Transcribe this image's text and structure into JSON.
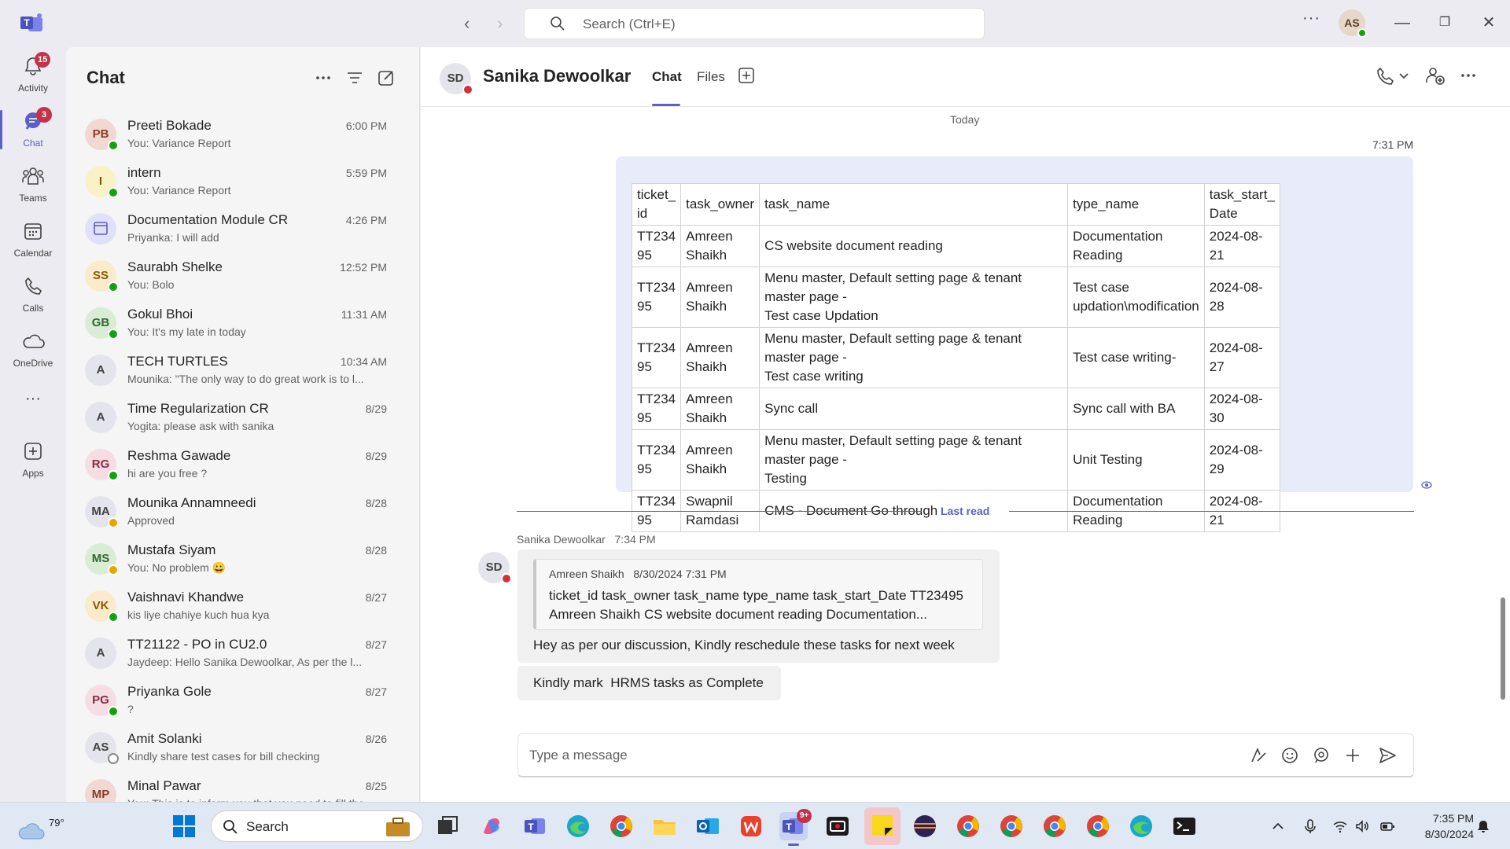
{
  "titlebar": {
    "search_placeholder": "Search (Ctrl+E)",
    "more_label": "···",
    "avatar_initials": "AS",
    "minimize": "—",
    "restore": "❐",
    "close": "✕"
  },
  "rail": {
    "items": [
      {
        "label": "Activity",
        "icon": "bell-icon",
        "badge": "15"
      },
      {
        "label": "Chat",
        "icon": "chat-icon",
        "badge": "3"
      },
      {
        "label": "Teams",
        "icon": "teams-icon"
      },
      {
        "label": "Calendar",
        "icon": "calendar-icon"
      },
      {
        "label": "Calls",
        "icon": "phone-icon"
      },
      {
        "label": "OneDrive",
        "icon": "cloud-icon"
      },
      {
        "label": "···",
        "icon": "more-icon"
      },
      {
        "label": "Apps",
        "icon": "plus-box-icon"
      }
    ]
  },
  "chatlist": {
    "title": "Chat",
    "items": [
      {
        "name": "Preeti Bokade",
        "preview": "You: Variance Report",
        "time": "6:00 PM",
        "initials": "PB",
        "status": "green",
        "av_bg": "#f1d9d2",
        "av_fg": "#8a3c2a"
      },
      {
        "name": "intern",
        "preview": "You: Variance Report",
        "time": "5:59 PM",
        "initials": "I",
        "status": "green",
        "av_bg": "#fbf1c6",
        "av_fg": "#7a5c00"
      },
      {
        "name": "Documentation Module CR",
        "preview": "Priyanka: I will add",
        "time": "4:26 PM",
        "initials": "",
        "status": "",
        "av_bg": "#dfe1f8",
        "av_fg": "#5b5fc7"
      },
      {
        "name": "Saurabh Shelke",
        "preview": "You: Bolo",
        "time": "12:52 PM",
        "initials": "SS",
        "status": "green",
        "av_bg": "#fbeacb",
        "av_fg": "#8a5a00"
      },
      {
        "name": "Gokul Bhoi",
        "preview": "You: It's my late in today",
        "time": "11:31 AM",
        "initials": "GB",
        "status": "green",
        "av_bg": "#d9ecd5",
        "av_fg": "#2d6a2d"
      },
      {
        "name": "TECH TURTLES",
        "preview": "Mounika: \"The only way to do great work is to l...",
        "time": "10:34 AM",
        "initials": "A",
        "status": "",
        "av_bg": "#e4e4ec",
        "av_fg": "#424242"
      },
      {
        "name": "Time Regularization CR",
        "preview": "Yogita: please ask with sanika",
        "time": "8/29",
        "initials": "A",
        "status": "",
        "av_bg": "#e4e4ec",
        "av_fg": "#424242"
      },
      {
        "name": "Reshma Gawade",
        "preview": "hi are you free ?",
        "time": "8/29",
        "initials": "RG",
        "status": "green",
        "av_bg": "#f6dde3",
        "av_fg": "#8a2a44"
      },
      {
        "name": "Mounika Annamneedi",
        "preview": "Approved",
        "time": "8/28",
        "initials": "MA",
        "status": "yellow",
        "av_bg": "#e4e4ec",
        "av_fg": "#424242"
      },
      {
        "name": "Mustafa Siyam",
        "preview": "You: No problem 😀",
        "time": "8/28",
        "initials": "MS",
        "status": "yellow",
        "av_bg": "#d9ecd5",
        "av_fg": "#2d6a2d"
      },
      {
        "name": "Vaishnavi Khandwe",
        "preview": "kis liye chahiye kuch hua kya",
        "time": "8/27",
        "initials": "VK",
        "status": "green",
        "av_bg": "#fbeacb",
        "av_fg": "#8a5a00"
      },
      {
        "name": "TT21122 - PO in CU2.0",
        "preview": "Jaydeep: Hello Sanika Dewoolkar,   As per the l...",
        "time": "8/27",
        "initials": "A",
        "status": "",
        "av_bg": "#e4e4ec",
        "av_fg": "#424242"
      },
      {
        "name": "Priyanka Gole",
        "preview": "?",
        "time": "8/27",
        "initials": "PG",
        "status": "green",
        "av_bg": "#f6dde3",
        "av_fg": "#8a2a44"
      },
      {
        "name": "Amit Solanki",
        "preview": "Kindly share test cases for bill checking",
        "time": "8/26",
        "initials": "AS",
        "status": "gray",
        "av_bg": "#e4e4ec",
        "av_fg": "#424242"
      },
      {
        "name": "Minal Pawar",
        "preview": "You: This is to inform you that you need to fill the ...",
        "time": "8/25",
        "initials": "MP",
        "status": "",
        "av_bg": "#f1d9d2",
        "av_fg": "#8a3c2a"
      }
    ]
  },
  "conversation": {
    "avatar_initials": "SD",
    "name": "Sanika Dewoolkar",
    "tabs": [
      "Chat",
      "Files"
    ],
    "day_separator": "Today",
    "my_message_time": "7:31 PM",
    "table": {
      "headers": [
        "ticket_\nid",
        "task_owner",
        "task_name",
        "type_name",
        "task_start_\nDate"
      ],
      "rows": [
        [
          "TT234\n95",
          "Amreen\nShaikh",
          "CS website document reading",
          "Documentation Reading",
          "2024-08-21"
        ],
        [
          "TT234\n95",
          "Amreen\nShaikh",
          "Menu master, Default setting page & tenant master page -\nTest case Updation",
          "Test case\nupdation\\modification",
          "2024-08-28"
        ],
        [
          "TT234\n95",
          "Amreen\nShaikh",
          "Menu master, Default setting page & tenant master page -\nTest case writing",
          "Test case writing-",
          "2024-08-27"
        ],
        [
          "TT234\n95",
          "Amreen\nShaikh",
          "Sync call",
          "Sync call with BA",
          "2024-08-30"
        ],
        [
          "TT234\n95",
          "Amreen\nShaikh",
          "Menu master, Default setting page & tenant master page -\nTesting",
          "Unit Testing",
          "2024-08-29"
        ],
        [
          "TT234\n95",
          "Swapnil\nRamdasi",
          "CMS - Document Go through",
          "Documentation Reading",
          "2024-08-21"
        ]
      ]
    },
    "last_read": "Last read",
    "reply_sender": "Sanika Dewoolkar",
    "reply_time": "7:34 PM",
    "reply_avatar": "SD",
    "quote_author": "Amreen Shaikh",
    "quote_time": "8/30/2024 7:31 PM",
    "quote_text": "ticket_id task_owner task_name type_name task_start_Date TT23495 Amreen Shaikh CS website document reading Documentation...",
    "reply_text": "Hey as per our discussion, Kindly reschedule these tasks for next week",
    "second_text": "Kindly mark  HRMS tasks as Complete",
    "compose_placeholder": "Type a message"
  },
  "taskbar": {
    "weather_temp": "79°",
    "search_label": "Search",
    "teams_badge": "9+",
    "clock_time": "7:35 PM",
    "clock_date": "8/30/2024"
  },
  "colors": {
    "accent": "#5b5fc7",
    "badge_red": "#c4314b",
    "my_bubble": "#e8ebfa",
    "presence_green": "#13a10e",
    "presence_red": "#d13438",
    "presence_yellow": "#eaa300"
  }
}
